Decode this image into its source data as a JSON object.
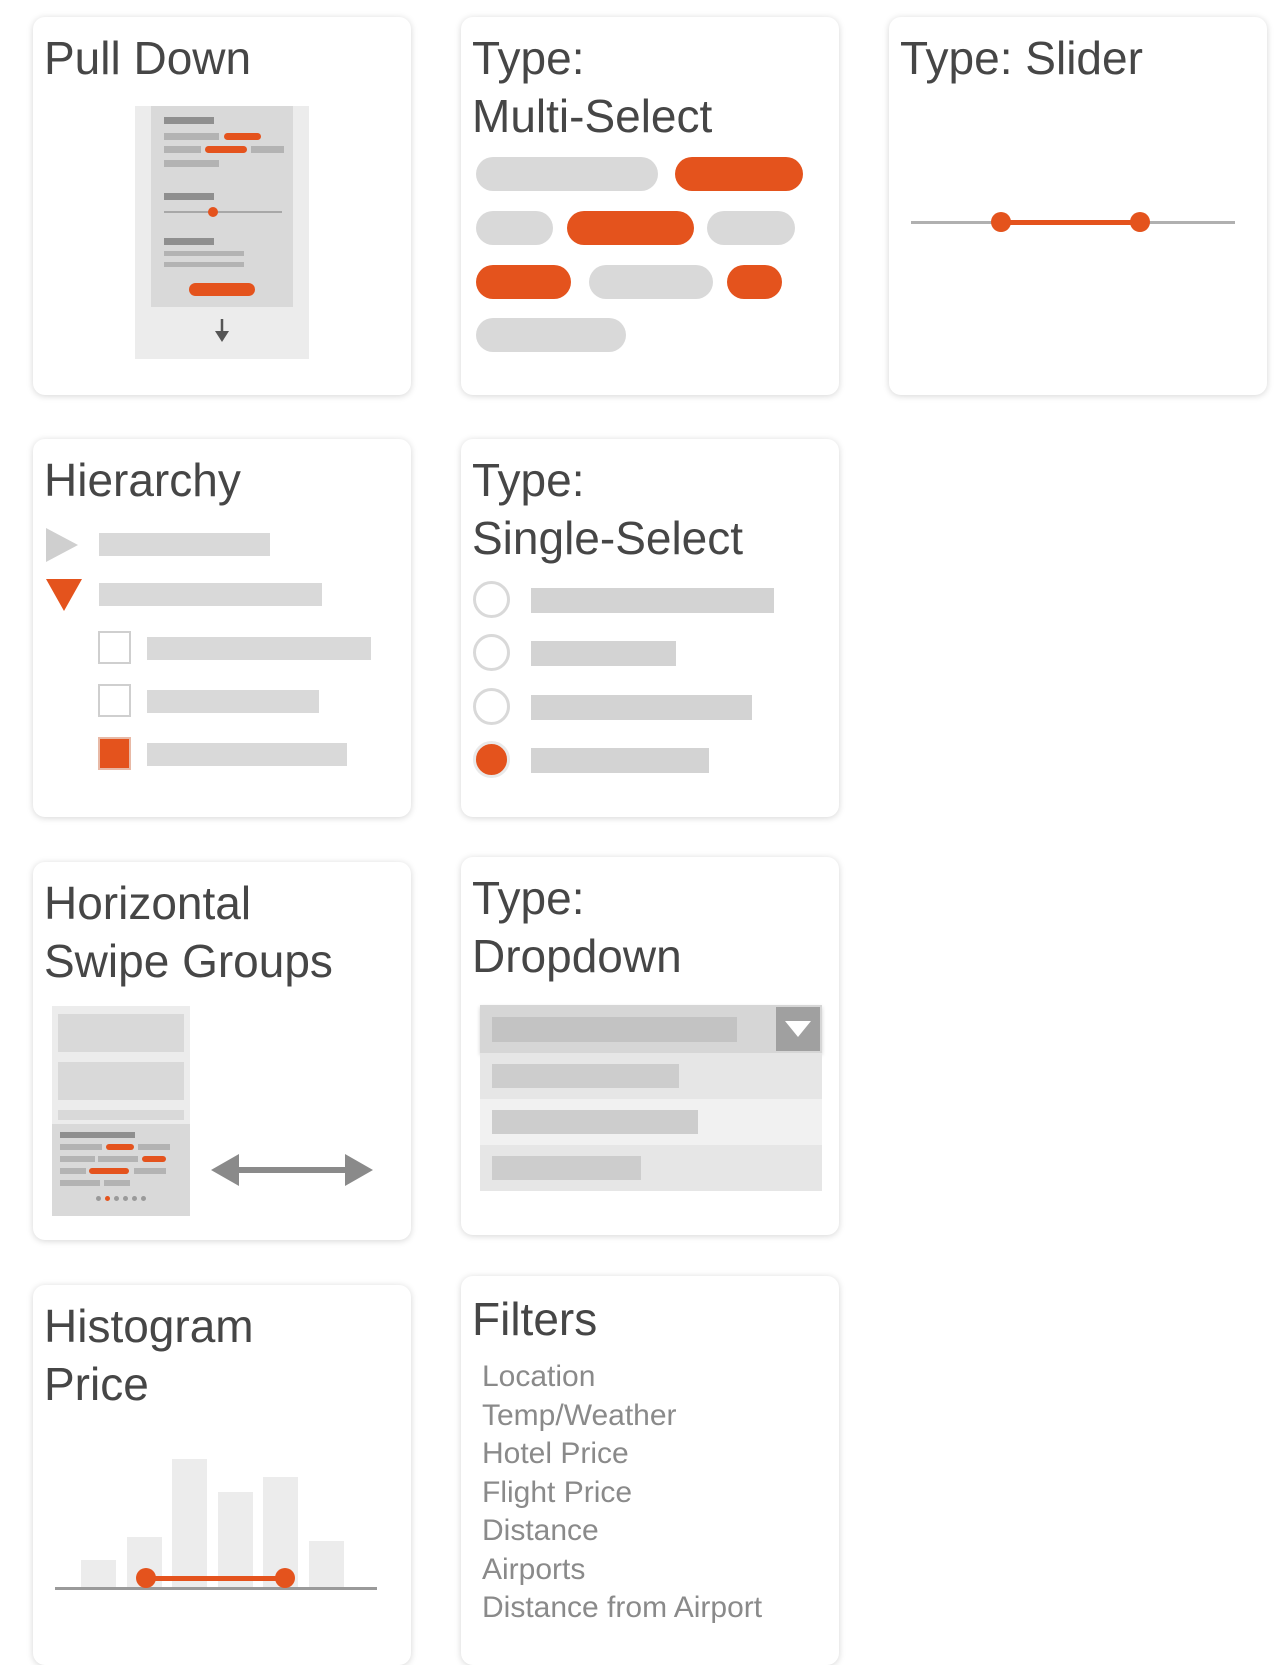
{
  "colors": {
    "accent": "#e4531d",
    "placeholder": "#d9d9d9",
    "text": "#464646",
    "muted": "#8a8a8a"
  },
  "cards": {
    "pull_down": {
      "title": "Pull Down",
      "icon": "arrow-down-icon"
    },
    "multi_select": {
      "title": "Type:\nMulti-Select",
      "selected_chips": 4,
      "total_chips": 9
    },
    "slider": {
      "title": "Type: Slider",
      "range_low": 0.28,
      "range_high": 0.71
    },
    "hierarchy": {
      "title": "Hierarchy",
      "collapsed_icon": "caret-right-icon",
      "expanded_icon": "caret-down-icon",
      "checked_index": 3
    },
    "single_select": {
      "title": "Type:\nSingle-Select",
      "selected_index": 4
    },
    "horizontal_swipe": {
      "title": "Horizontal\nSwipe Groups",
      "icon": "double-arrow-icon"
    },
    "dropdown": {
      "title": "Type:\nDropdown",
      "icon": "chevron-down-icon"
    },
    "histogram": {
      "title": "Histogram\nPrice",
      "bar_levels": [
        0.21,
        0.39,
        1.0,
        0.74,
        0.86,
        0.36
      ],
      "range_low": 0.28,
      "range_high": 0.71
    },
    "filters": {
      "title": "Filters",
      "items": [
        "Location",
        "Temp/Weather",
        "Hotel Price",
        "Flight Price",
        "Distance",
        "Airports",
        "Distance from Airport"
      ]
    }
  }
}
